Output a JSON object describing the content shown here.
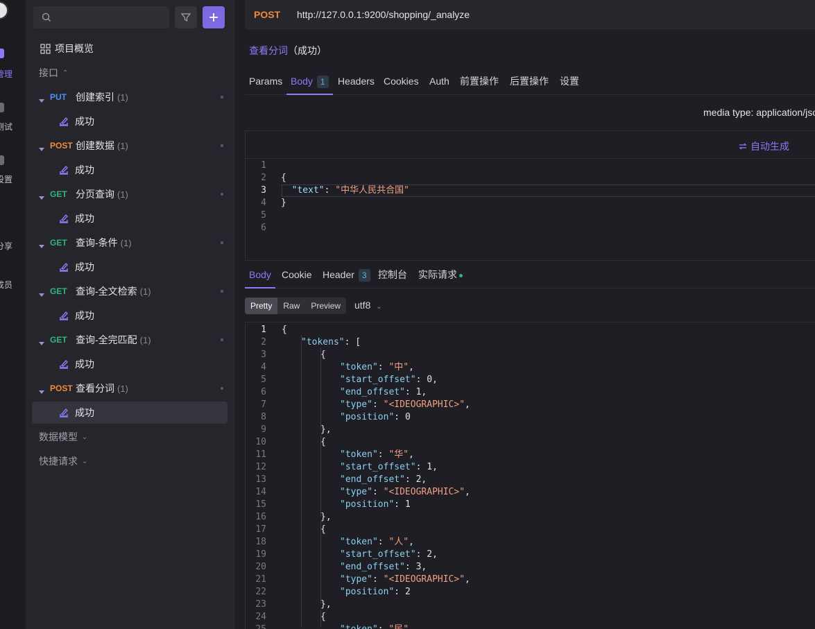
{
  "rail": {
    "items": [
      {
        "label": "管理",
        "active": true
      },
      {
        "label": "测试",
        "active": false
      },
      {
        "label": "设置",
        "active": false
      },
      {
        "label": "分享",
        "active": false
      },
      {
        "label": "成员",
        "active": false
      }
    ]
  },
  "sidebar": {
    "search": {
      "placeholder": ""
    },
    "overview_label": "项目概览",
    "sections": {
      "apis": "接口",
      "models": "数据模型",
      "quick": "快捷请求"
    },
    "apis": [
      {
        "method": "PUT",
        "name": "创建索引",
        "count": "(1)",
        "case": "成功"
      },
      {
        "method": "POST",
        "name": "创建数据",
        "count": "(1)",
        "case": "成功"
      },
      {
        "method": "GET",
        "name": "分页查询",
        "count": "(1)",
        "case": "成功"
      },
      {
        "method": "GET",
        "name": "查询-条件",
        "count": "(1)",
        "case": "成功"
      },
      {
        "method": "GET",
        "name": "查询-全文检索",
        "count": "(1)",
        "case": "成功"
      },
      {
        "method": "GET",
        "name": "查询-全完匹配",
        "count": "(1)",
        "case": "成功"
      },
      {
        "method": "POST",
        "name": "查看分词",
        "count": "(1)",
        "case": "成功"
      }
    ]
  },
  "request": {
    "method": "POST",
    "url": "http://127.0.0.1:9200/shopping/_analyze",
    "case_title": "查看分词",
    "case_status": "（成功）",
    "tabs": [
      {
        "label": "Params"
      },
      {
        "label": "Body",
        "badge": "1",
        "active": true
      },
      {
        "label": "Headers"
      },
      {
        "label": "Cookies"
      },
      {
        "label": "Auth"
      },
      {
        "label": "前置操作"
      },
      {
        "label": "后置操作"
      },
      {
        "label": "设置"
      }
    ],
    "media_type": "media type: application/json",
    "auto_generate": "自动生成",
    "body_lines": [
      {
        "n": "1",
        "text": ""
      },
      {
        "n": "2",
        "text": "{"
      },
      {
        "n": "3",
        "key": "\"text\"",
        "value": "\"中华人民共合国\""
      },
      {
        "n": "4",
        "text": "}"
      },
      {
        "n": "5",
        "text": ""
      },
      {
        "n": "6",
        "text": ""
      }
    ]
  },
  "response": {
    "tabs": [
      {
        "label": "Body",
        "active": true
      },
      {
        "label": "Cookie"
      },
      {
        "label": "Header",
        "badge": "3"
      },
      {
        "label": "控制台"
      },
      {
        "label": "实际请求"
      }
    ],
    "view_modes": [
      "Pretty",
      "Raw",
      "Preview"
    ],
    "active_mode": "Pretty",
    "encoding": "utf8",
    "lines": [
      {
        "n": "1",
        "indent": 0,
        "parts": [
          [
            "pun",
            "{"
          ]
        ]
      },
      {
        "n": "2",
        "indent": 1,
        "parts": [
          [
            "key",
            "\"tokens\""
          ],
          [
            "pun",
            ": ["
          ]
        ]
      },
      {
        "n": "3",
        "indent": 2,
        "parts": [
          [
            "pun",
            "{"
          ]
        ]
      },
      {
        "n": "4",
        "indent": 3,
        "parts": [
          [
            "key",
            "\"token\""
          ],
          [
            "pun",
            ": "
          ],
          [
            "str",
            "\"中\""
          ],
          [
            "pun",
            ","
          ]
        ]
      },
      {
        "n": "5",
        "indent": 3,
        "parts": [
          [
            "key",
            "\"start_offset\""
          ],
          [
            "pun",
            ": "
          ],
          [
            "num",
            "0"
          ],
          [
            "pun",
            ","
          ]
        ]
      },
      {
        "n": "6",
        "indent": 3,
        "parts": [
          [
            "key",
            "\"end_offset\""
          ],
          [
            "pun",
            ": "
          ],
          [
            "num",
            "1"
          ],
          [
            "pun",
            ","
          ]
        ]
      },
      {
        "n": "7",
        "indent": 3,
        "parts": [
          [
            "key",
            "\"type\""
          ],
          [
            "pun",
            ": "
          ],
          [
            "str",
            "\"<IDEOGRAPHIC>\""
          ],
          [
            "pun",
            ","
          ]
        ]
      },
      {
        "n": "8",
        "indent": 3,
        "parts": [
          [
            "key",
            "\"position\""
          ],
          [
            "pun",
            ": "
          ],
          [
            "num",
            "0"
          ]
        ]
      },
      {
        "n": "9",
        "indent": 2,
        "parts": [
          [
            "pun",
            "},"
          ]
        ]
      },
      {
        "n": "10",
        "indent": 2,
        "parts": [
          [
            "pun",
            "{"
          ]
        ]
      },
      {
        "n": "11",
        "indent": 3,
        "parts": [
          [
            "key",
            "\"token\""
          ],
          [
            "pun",
            ": "
          ],
          [
            "str",
            "\"华\""
          ],
          [
            "pun",
            ","
          ]
        ]
      },
      {
        "n": "12",
        "indent": 3,
        "parts": [
          [
            "key",
            "\"start_offset\""
          ],
          [
            "pun",
            ": "
          ],
          [
            "num",
            "1"
          ],
          [
            "pun",
            ","
          ]
        ]
      },
      {
        "n": "13",
        "indent": 3,
        "parts": [
          [
            "key",
            "\"end_offset\""
          ],
          [
            "pun",
            ": "
          ],
          [
            "num",
            "2"
          ],
          [
            "pun",
            ","
          ]
        ]
      },
      {
        "n": "14",
        "indent": 3,
        "parts": [
          [
            "key",
            "\"type\""
          ],
          [
            "pun",
            ": "
          ],
          [
            "str",
            "\"<IDEOGRAPHIC>\""
          ],
          [
            "pun",
            ","
          ]
        ]
      },
      {
        "n": "15",
        "indent": 3,
        "parts": [
          [
            "key",
            "\"position\""
          ],
          [
            "pun",
            ": "
          ],
          [
            "num",
            "1"
          ]
        ]
      },
      {
        "n": "16",
        "indent": 2,
        "parts": [
          [
            "pun",
            "},"
          ]
        ]
      },
      {
        "n": "17",
        "indent": 2,
        "parts": [
          [
            "pun",
            "{"
          ]
        ]
      },
      {
        "n": "18",
        "indent": 3,
        "parts": [
          [
            "key",
            "\"token\""
          ],
          [
            "pun",
            ": "
          ],
          [
            "str",
            "\"人\""
          ],
          [
            "pun",
            ","
          ]
        ]
      },
      {
        "n": "19",
        "indent": 3,
        "parts": [
          [
            "key",
            "\"start_offset\""
          ],
          [
            "pun",
            ": "
          ],
          [
            "num",
            "2"
          ],
          [
            "pun",
            ","
          ]
        ]
      },
      {
        "n": "20",
        "indent": 3,
        "parts": [
          [
            "key",
            "\"end_offset\""
          ],
          [
            "pun",
            ": "
          ],
          [
            "num",
            "3"
          ],
          [
            "pun",
            ","
          ]
        ]
      },
      {
        "n": "21",
        "indent": 3,
        "parts": [
          [
            "key",
            "\"type\""
          ],
          [
            "pun",
            ": "
          ],
          [
            "str",
            "\"<IDEOGRAPHIC>\""
          ],
          [
            "pun",
            ","
          ]
        ]
      },
      {
        "n": "22",
        "indent": 3,
        "parts": [
          [
            "key",
            "\"position\""
          ],
          [
            "pun",
            ": "
          ],
          [
            "num",
            "2"
          ]
        ]
      },
      {
        "n": "23",
        "indent": 2,
        "parts": [
          [
            "pun",
            "},"
          ]
        ]
      },
      {
        "n": "24",
        "indent": 2,
        "parts": [
          [
            "pun",
            "{"
          ]
        ]
      },
      {
        "n": "25",
        "indent": 3,
        "parts": [
          [
            "key",
            "\"token\""
          ],
          [
            "pun",
            ": "
          ],
          [
            "str",
            "\"民\""
          ],
          [
            "pun",
            ","
          ]
        ]
      }
    ]
  },
  "colors": {
    "accent": "#8b7cf6",
    "put": "#4f8ef7",
    "post": "#f08a3c",
    "get": "#2fb67c"
  }
}
